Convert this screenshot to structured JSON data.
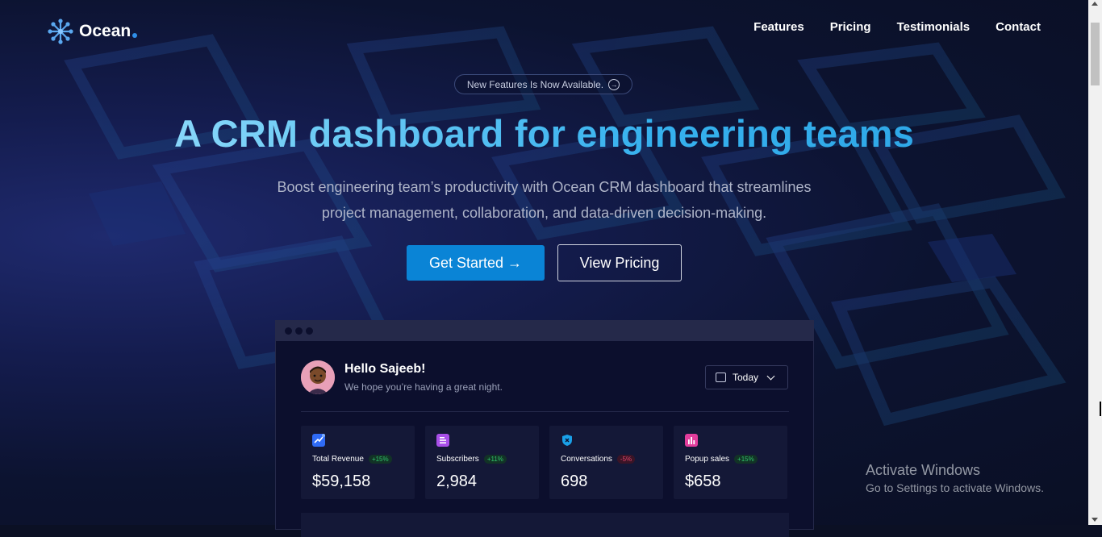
{
  "nav": {
    "brand": "Ocean",
    "links": [
      "Features",
      "Pricing",
      "Testimonials",
      "Contact"
    ]
  },
  "hero": {
    "badge": "New Features Is Now Available.",
    "title": "A CRM dashboard for engineering teams",
    "subtitle_line1": "Boost engineering team’s productivity with Ocean CRM dashboard that streamlines",
    "subtitle_line2": "project management, collaboration, and data-driven decision-making.",
    "cta_primary": "Get Started →",
    "cta_secondary": "View Pricing"
  },
  "dashboard": {
    "greeting": "Hello Sajeeb!",
    "greeting_sub": "We hope you’re having a great night.",
    "date_filter": "Today",
    "cards": [
      {
        "label": "Total Revenue",
        "change": "+15%",
        "value": "$59,158",
        "icon": "trend-icon",
        "color": "#2f6bf5"
      },
      {
        "label": "Subscribers",
        "change": "+11%",
        "value": "2,984",
        "icon": "document-icon",
        "color": "#a84fe8"
      },
      {
        "label": "Conversations",
        "change": "-5%",
        "value": "698",
        "icon": "shield-icon",
        "color": "#1aa0e8"
      },
      {
        "label": "Popup sales",
        "change": "+15%",
        "value": "$658",
        "icon": "bar-chart-icon",
        "color": "#e23d9c"
      }
    ]
  },
  "watermark": {
    "title": "Activate Windows",
    "subtitle": "Go to Settings to activate Windows."
  },
  "colors": {
    "accent": "#0a84d6",
    "background": "#0b1024"
  }
}
